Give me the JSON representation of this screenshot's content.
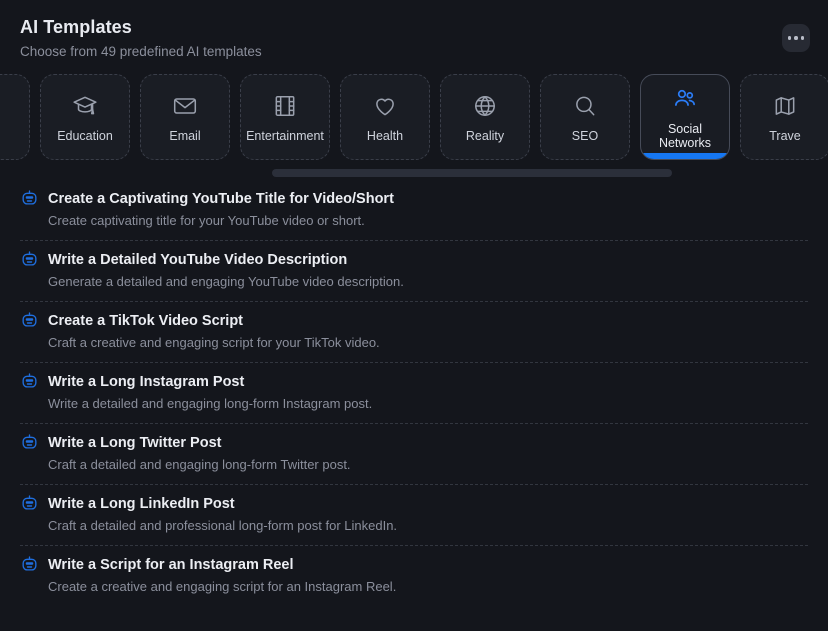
{
  "header": {
    "title": "AI Templates",
    "subtitle": "Choose from 49 predefined AI templates",
    "more_label": "More options",
    "accent_color": "#1677f2",
    "background_color": "#14161c"
  },
  "tabs": {
    "scrollbar": {
      "visible": true
    },
    "items": [
      {
        "label": "",
        "icon": "partial-tab",
        "active": false,
        "partial": true
      },
      {
        "label": "Education",
        "icon": "graduation-cap-icon",
        "active": false
      },
      {
        "label": "Email",
        "icon": "envelope-icon",
        "active": false
      },
      {
        "label": "Entertainment",
        "icon": "film-strip-icon",
        "active": false
      },
      {
        "label": "Health",
        "icon": "heart-icon",
        "active": false
      },
      {
        "label": "Reality",
        "icon": "globe-icon",
        "active": false
      },
      {
        "label": "SEO",
        "icon": "magnifier-icon",
        "active": false
      },
      {
        "label": "Social Networks",
        "icon": "users-icon",
        "active": true
      },
      {
        "label": "Trave",
        "icon": "map-icon",
        "active": false
      }
    ]
  },
  "templates": [
    {
      "title": "Create a Captivating YouTube Title for Video/Short",
      "description": "Create captivating title for your YouTube video or short.",
      "icon": "robot-icon"
    },
    {
      "title": "Write a Detailed YouTube Video Description",
      "description": "Generate a detailed and engaging YouTube video description.",
      "icon": "robot-icon"
    },
    {
      "title": "Create a TikTok Video Script",
      "description": "Craft a creative and engaging script for your TikTok video.",
      "icon": "robot-icon"
    },
    {
      "title": "Write a Long Instagram Post",
      "description": "Write a detailed and engaging long-form Instagram post.",
      "icon": "robot-icon"
    },
    {
      "title": "Write a Long Twitter Post",
      "description": "Craft a detailed and engaging long-form Twitter post.",
      "icon": "robot-icon"
    },
    {
      "title": "Write a Long LinkedIn Post",
      "description": "Craft a detailed and professional long-form post for LinkedIn.",
      "icon": "robot-icon"
    },
    {
      "title": "Write a Script for an Instagram Reel",
      "description": "Create a creative and engaging script for an Instagram Reel.",
      "icon": "robot-icon"
    }
  ]
}
